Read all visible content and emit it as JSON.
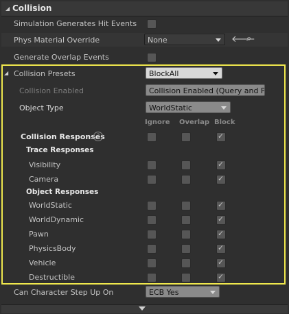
{
  "header": {
    "title": "Collision"
  },
  "props": {
    "sim_hit_events": "Simulation Generates Hit Events",
    "phys_material": "Phys Material Override",
    "phys_material_value": "None",
    "overlap_events": "Generate Overlap Events",
    "collision_presets": "Collision Presets",
    "collision_presets_value": "BlockAll",
    "collision_enabled": "Collision Enabled",
    "collision_enabled_value": "Collision Enabled (Query and P",
    "object_type": "Object Type",
    "object_type_value": "WorldStatic",
    "columns": {
      "ignore": "Ignore",
      "overlap": "Overlap",
      "block": "Block"
    },
    "collision_responses": "Collision Responses",
    "trace_responses": "Trace Responses",
    "trace_items": [
      {
        "label": "Visibility",
        "ignore": false,
        "overlap": false,
        "block": true
      },
      {
        "label": "Camera",
        "ignore": false,
        "overlap": false,
        "block": true
      }
    ],
    "object_responses": "Object Responses",
    "object_items": [
      {
        "label": "WorldStatic",
        "ignore": false,
        "overlap": false,
        "block": true
      },
      {
        "label": "WorldDynamic",
        "ignore": false,
        "overlap": false,
        "block": true
      },
      {
        "label": "Pawn",
        "ignore": false,
        "overlap": false,
        "block": true
      },
      {
        "label": "PhysicsBody",
        "ignore": false,
        "overlap": false,
        "block": true
      },
      {
        "label": "Vehicle",
        "ignore": false,
        "overlap": false,
        "block": true
      },
      {
        "label": "Destructible",
        "ignore": false,
        "overlap": false,
        "block": true
      }
    ],
    "step_up": "Can Character Step Up On",
    "step_up_value": "ECB Yes"
  },
  "colors": {
    "highlight": "#f0e84d",
    "panel": "#2f2f2f"
  }
}
